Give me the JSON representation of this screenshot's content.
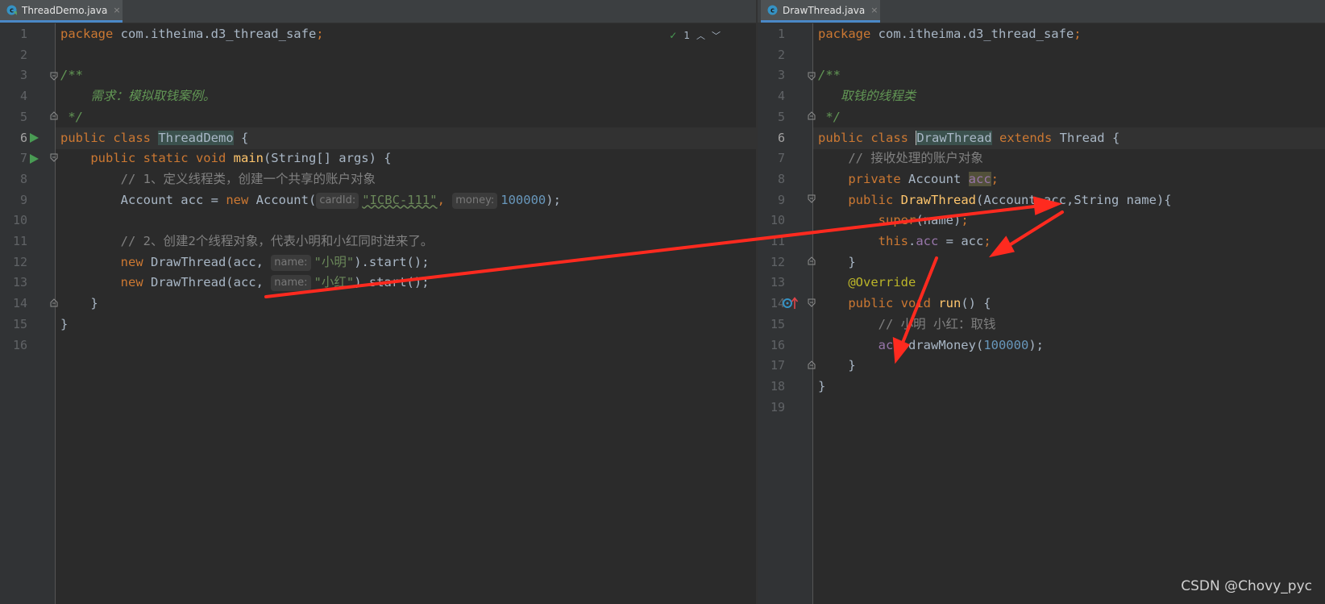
{
  "left_pane": {
    "tab": {
      "label": "ThreadDemo.java",
      "close": "×"
    },
    "inspection": {
      "count": "1"
    },
    "line_numbers": [
      "1",
      "2",
      "3",
      "4",
      "5",
      "6",
      "7",
      "8",
      "9",
      "10",
      "11",
      "12",
      "13",
      "14",
      "15",
      "16"
    ],
    "code": {
      "l1_kw": "package",
      "l1_pkg": " com.itheima.d3_thread_safe",
      "l1_semi": ";",
      "l3": "/**",
      "l4": "    需求：模拟取钱案例。",
      "l5": " */",
      "l6_kw": "public class ",
      "l6_cls": "ThreadDemo",
      "l6_rest": " {",
      "l7_indent": "    ",
      "l7_kw": "public static void ",
      "l7_fn": "main",
      "l7_rest": "(String[] args) {",
      "l8_indent": "        ",
      "l8_cmt": "// 1、定义线程类，创建一个共享的账户对象",
      "l9_pre": "        Account acc = ",
      "l9_kw": "new",
      "l9_mid": " Account(",
      "l9_hint1": "cardId:",
      "l9_str": "\"ICBC-111\"",
      "l9_comma": ", ",
      "l9_hint2": "money:",
      "l9_num": "100000",
      "l9_end": ");",
      "l11_indent": "        ",
      "l11_cmt": "// 2、创建2个线程对象，代表小明和小红同时进来了。",
      "l12_indent": "        ",
      "l12_kw": "new",
      "l12_mid": " DrawThread(acc, ",
      "l12_hint": "name:",
      "l12_str": "\"小明\"",
      "l12_end": ").start();",
      "l13_indent": "        ",
      "l13_kw": "new",
      "l13_mid": " DrawThread(acc, ",
      "l13_hint": "name:",
      "l13_str": "\"小红\"",
      "l13_end": ").start();",
      "l14": "    }",
      "l15": "}"
    }
  },
  "right_pane": {
    "tab": {
      "label": "DrawThread.java",
      "close": "×"
    },
    "line_numbers": [
      "1",
      "2",
      "3",
      "4",
      "5",
      "6",
      "7",
      "8",
      "9",
      "10",
      "11",
      "12",
      "13",
      "14",
      "15",
      "16",
      "17",
      "18",
      "19"
    ],
    "code": {
      "l1_kw": "package",
      "l1_pkg": " com.itheima.d3_thread_safe",
      "l1_semi": ";",
      "l3": "/**",
      "l4": "   取钱的线程类",
      "l5": " */",
      "l6_kw": "public class ",
      "l6_cls": "DrawThread",
      "l6_kw2": " extends",
      "l6_rest": " Thread {",
      "l7_indent": "    ",
      "l7_cmt": "// 接收处理的账户对象",
      "l8_indent": "    ",
      "l8_kw": "private",
      "l8_mid": " Account ",
      "l8_field": "acc",
      "l8_semi": ";",
      "l9_indent": "    ",
      "l9_kw": "public",
      "l9_sp": " ",
      "l9_fn": "DrawThread",
      "l9_rest": "(Account acc,String name){",
      "l10_indent": "        ",
      "l10_kw": "super",
      "l10_rest": "(name)",
      "l10_semi": ";",
      "l11_indent": "        ",
      "l11_kw": "this",
      "l11_dot": ".",
      "l11_field": "acc",
      "l11_rest": " = acc",
      "l11_semi": ";",
      "l12": "    }",
      "l13_indent": "    ",
      "l13_ann": "@Override",
      "l14_indent": "    ",
      "l14_kw": "public void ",
      "l14_fn": "run",
      "l14_rest": "() {",
      "l15_indent": "        ",
      "l15_cmt": "// 小明 小红：取钱",
      "l16_indent": "        ",
      "l16_field": "acc",
      "l16_mid": ".drawMoney(",
      "l16_num": "100000",
      "l16_end": ");",
      "l17": "    }",
      "l18": "}"
    }
  },
  "watermark": "CSDN @Chovy_pyc",
  "colors": {
    "arrow": "#ff2a1f",
    "keyword": "#cc7832",
    "string": "#6a8759",
    "number": "#6897bb",
    "method": "#ffc66d",
    "field": "#9876aa",
    "doc_comment": "#629755"
  }
}
